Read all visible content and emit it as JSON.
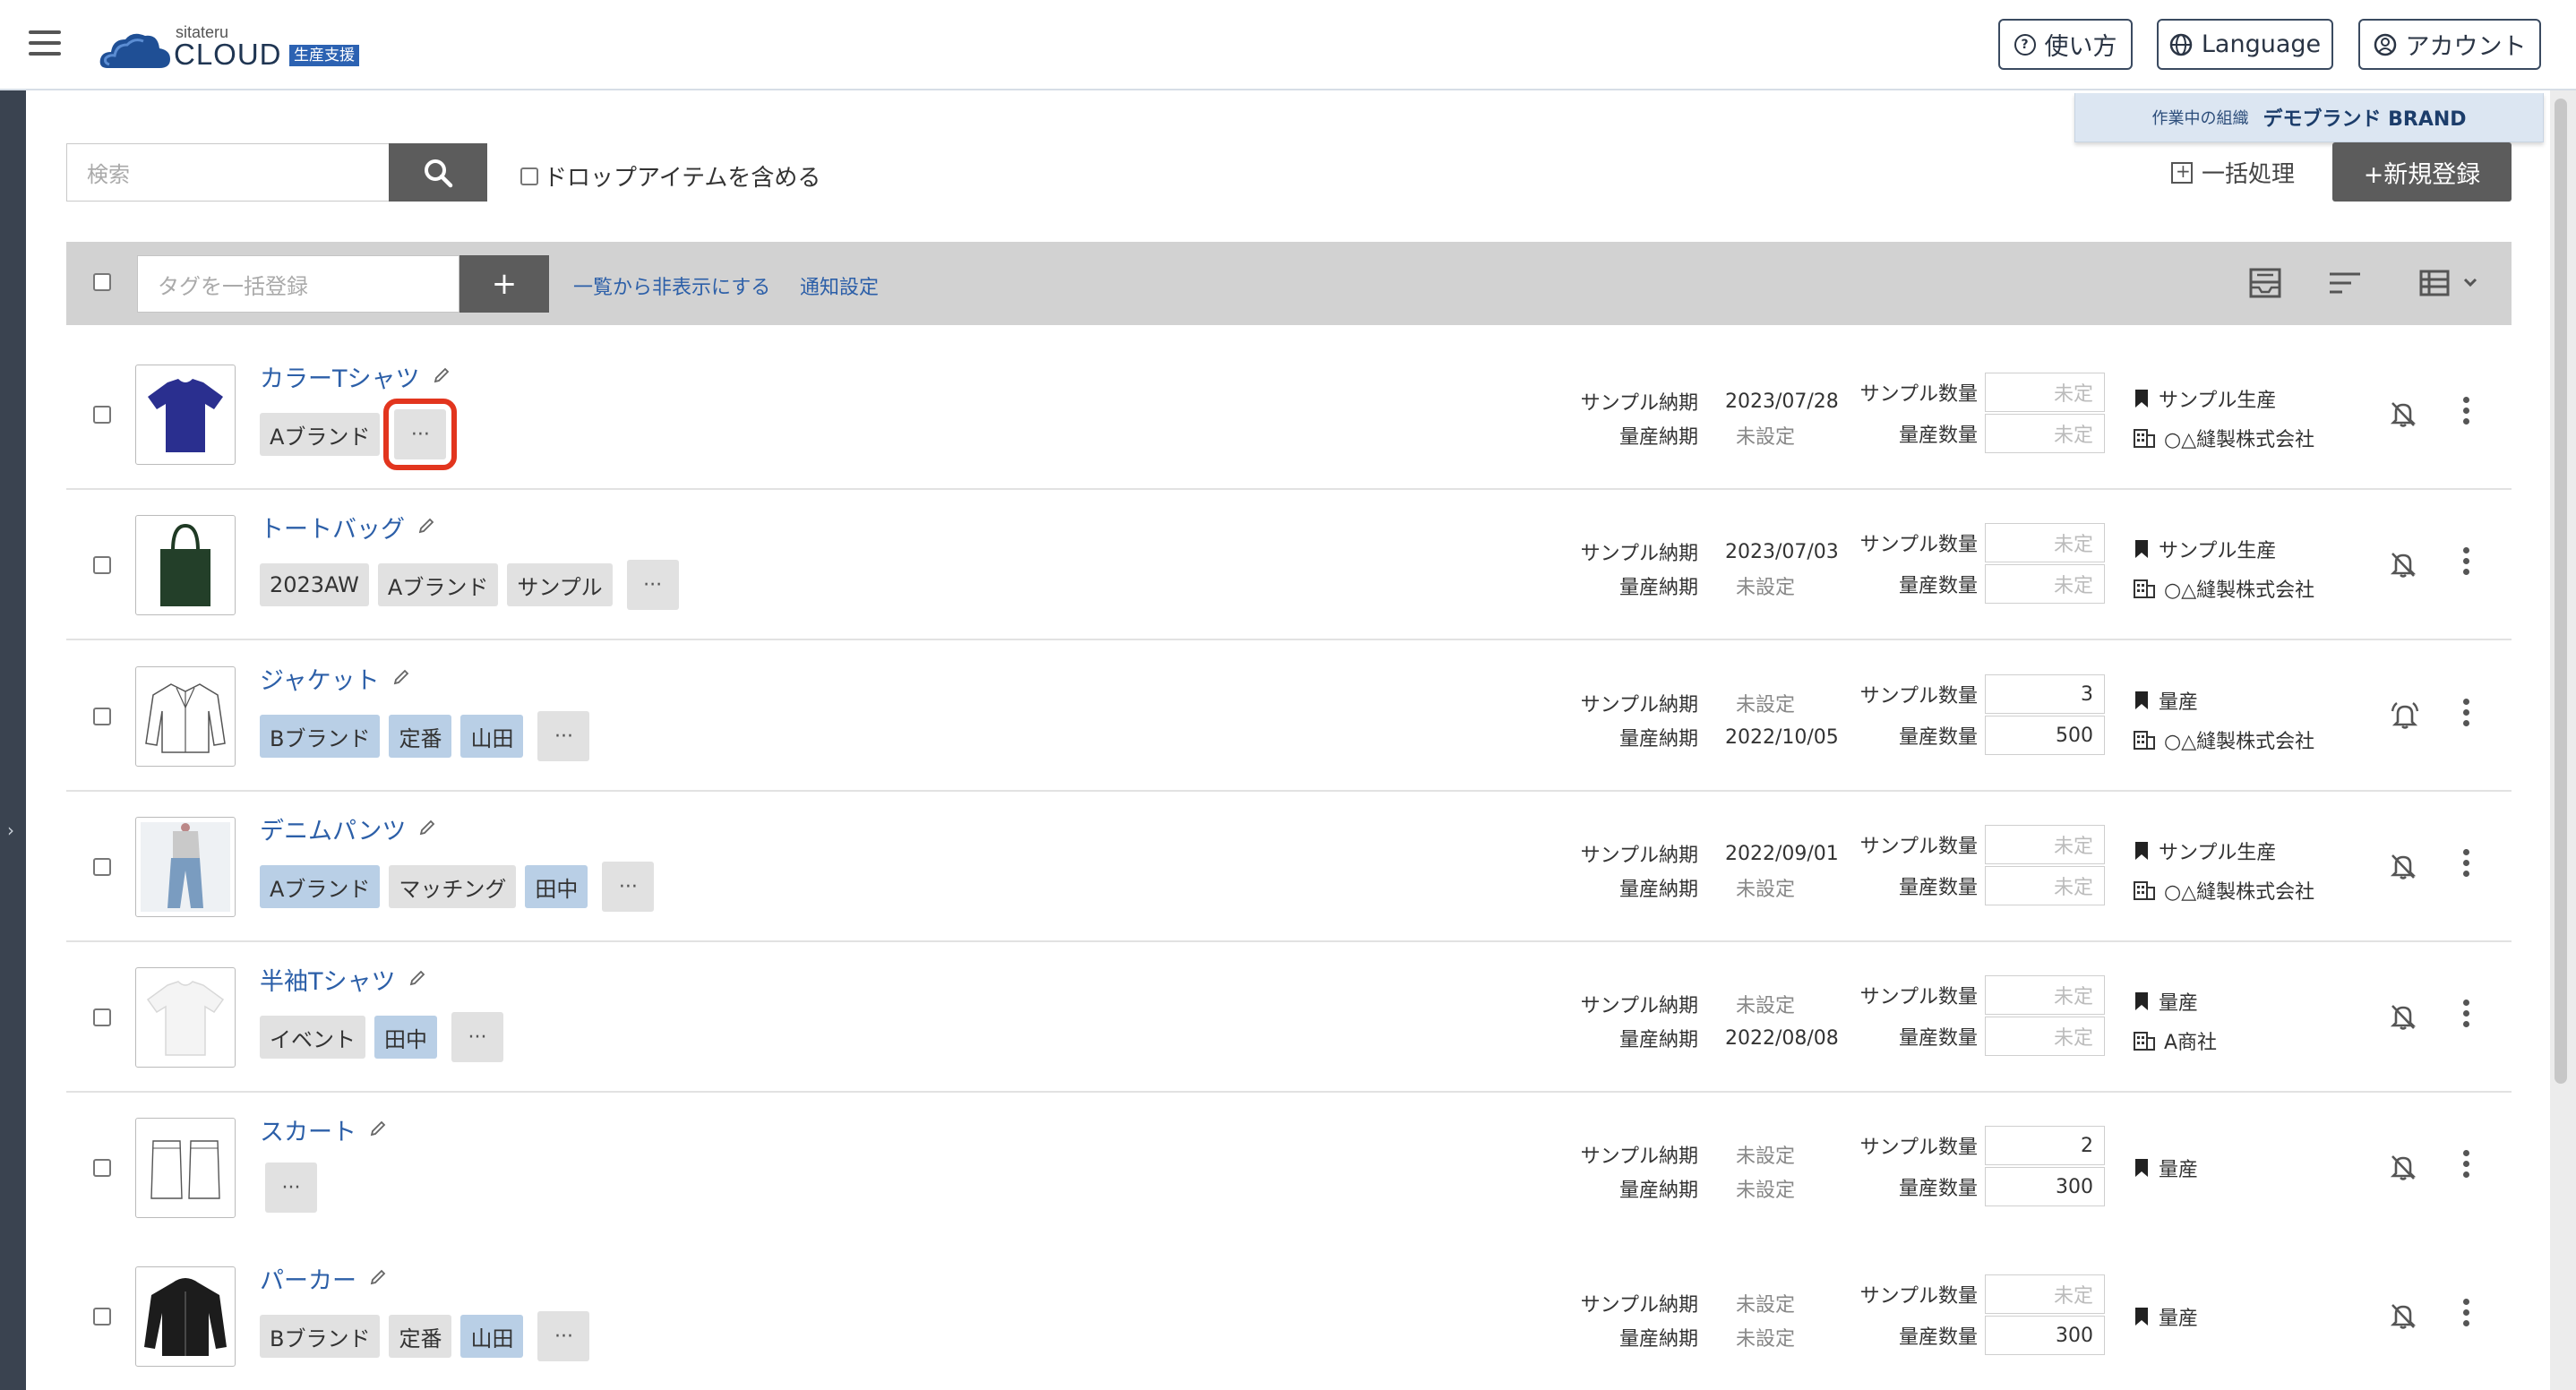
{
  "header": {
    "logo_small": "sitateru",
    "logo_big": "CLOUD",
    "logo_badge": "生産支援",
    "help_label": "使い方",
    "language_label": "Language",
    "account_label": "アカウント"
  },
  "org": {
    "label": "作業中の組織",
    "value": "デモブランド BRAND"
  },
  "search": {
    "placeholder": "検索",
    "drop_items_label": "ドロップアイテムを含める"
  },
  "actions": {
    "bulk_label": "一括処理",
    "new_label": "+新規登録"
  },
  "toolbar": {
    "tag_placeholder": "タグを一括登録",
    "add_label": "+",
    "hide_link": "一覧から非表示にする",
    "notify_link": "通知設定"
  },
  "labels": {
    "sample_date": "サンプル納期",
    "mass_date": "量産納期",
    "sample_qty": "サンプル数量",
    "mass_qty": "量産数量",
    "more": "···"
  },
  "items": [
    {
      "name": "カラーTシャツ",
      "tags": [
        {
          "text": "Aブランド",
          "color": "gray"
        }
      ],
      "sample_date": "2023/07/28",
      "mass_date": "未設定",
      "sample_qty": "未定",
      "mass_qty": "未定",
      "status": "サンプル生産",
      "factory": "○△縫製株式会社",
      "bell": "off",
      "thumb": "tshirt-navy-icon"
    },
    {
      "name": "トートバッグ",
      "tags": [
        {
          "text": "2023AW",
          "color": "gray"
        },
        {
          "text": "Aブランド",
          "color": "gray"
        },
        {
          "text": "サンプル",
          "color": "gray"
        }
      ],
      "sample_date": "2023/07/03",
      "mass_date": "未設定",
      "sample_qty": "未定",
      "mass_qty": "未定",
      "status": "サンプル生産",
      "factory": "○△縫製株式会社",
      "bell": "off",
      "thumb": "tote-bag-icon"
    },
    {
      "name": "ジャケット",
      "tags": [
        {
          "text": "Bブランド",
          "color": "blue"
        },
        {
          "text": "定番",
          "color": "blue"
        },
        {
          "text": "山田",
          "color": "blue"
        }
      ],
      "sample_date": "未設定",
      "mass_date": "2022/10/05",
      "sample_qty": "3",
      "mass_qty": "500",
      "status": "量産",
      "factory": "○△縫製株式会社",
      "bell": "on",
      "thumb": "jacket-sketch-icon"
    },
    {
      "name": "デニムパンツ",
      "tags": [
        {
          "text": "Aブランド",
          "color": "blue"
        },
        {
          "text": "マッチング",
          "color": "gray"
        },
        {
          "text": "田中",
          "color": "blue"
        }
      ],
      "sample_date": "2022/09/01",
      "mass_date": "未設定",
      "sample_qty": "未定",
      "mass_qty": "未定",
      "status": "サンプル生産",
      "factory": "○△縫製株式会社",
      "bell": "off",
      "thumb": "denim-pants-icon"
    },
    {
      "name": "半袖Tシャツ",
      "tags": [
        {
          "text": "イベント",
          "color": "gray"
        },
        {
          "text": "田中",
          "color": "blue"
        }
      ],
      "sample_date": "未設定",
      "mass_date": "2022/08/08",
      "sample_qty": "未定",
      "mass_qty": "未定",
      "status": "量産",
      "factory": "A商社",
      "bell": "off",
      "thumb": "tshirt-white-icon"
    },
    {
      "name": "スカート",
      "tags": [],
      "sample_date": "未設定",
      "mass_date": "未設定",
      "sample_qty": "2",
      "mass_qty": "300",
      "status": "量産",
      "factory": "",
      "bell": "off",
      "thumb": "skirt-sketch-icon"
    },
    {
      "name": "パーカー",
      "tags": [
        {
          "text": "Bブランド",
          "color": "gray"
        },
        {
          "text": "定番",
          "color": "gray"
        },
        {
          "text": "山田",
          "color": "blue"
        }
      ],
      "sample_date": "未設定",
      "mass_date": "未設定",
      "sample_qty": "未定",
      "mass_qty": "300",
      "status": "量産",
      "factory": "",
      "bell": "off",
      "thumb": "hoodie-black-icon"
    }
  ]
}
